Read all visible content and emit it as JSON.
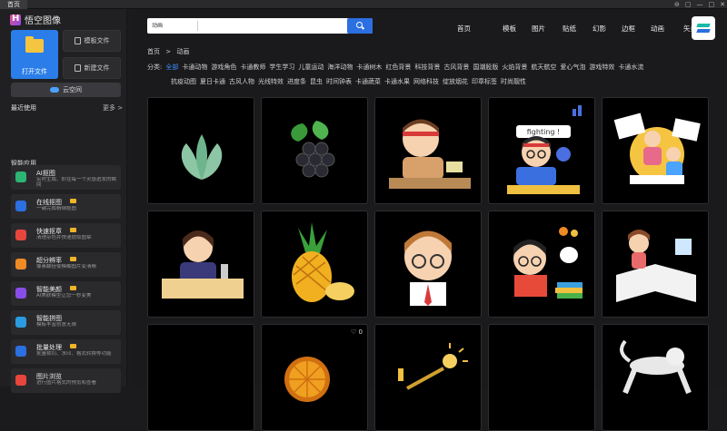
{
  "titlebar": {
    "tab": "首页",
    "controls": [
      "⊖",
      "▢",
      "—",
      "□",
      "✕"
    ]
  },
  "sidebar": {
    "app_title": "悟空图像",
    "open_file": "打开文件",
    "template_file": "模板文件",
    "new_file": "新建文件",
    "cloud": "云空间",
    "recent": "最近使用",
    "more": "更多 >",
    "smart_apps": "智能应用",
    "ai_items": [
      {
        "title": "AI抠图",
        "desc": "实时生成、抓住每一个灵感迸发的瞬间",
        "color": "#2bb673",
        "vip": false
      },
      {
        "title": "在线抠图",
        "desc": "一键完成精细抠图",
        "color": "#2b6fe0",
        "vip": true
      },
      {
        "title": "快速抠章",
        "desc": "清理杂色并快速提取图章",
        "color": "#e8453c",
        "vip": true
      },
      {
        "title": "超分辨率",
        "desc": "像素翻倍使模糊图片变清晰",
        "color": "#f08a24",
        "vip": true
      },
      {
        "title": "智能美颜",
        "desc": "AI美肤模型让您一秒变美",
        "color": "#8a4de8",
        "vip": true
      },
      {
        "title": "智能拼图",
        "desc": "模板丰富创意无限",
        "color": "#2b9be0",
        "vip": false
      },
      {
        "title": "批量处理",
        "desc": "批量裁切、水印、格式转换等功能",
        "color": "#2b6fe0",
        "vip": true
      },
      {
        "title": "图片浏览",
        "desc": "进行图片格式的预览和查看",
        "color": "#e8453c",
        "vip": false
      }
    ]
  },
  "search": {
    "category": "动画",
    "placeholder": ""
  },
  "nav": [
    "首页",
    "模板",
    "图片",
    "贴纸",
    "幻影",
    "边框",
    "动画",
    "矢量"
  ],
  "breadcrumb": {
    "home": "首页",
    "sep": ">",
    "current": "动画"
  },
  "categories": {
    "label": "分类:",
    "row1": [
      "全部",
      "卡通动物",
      "游戏角色",
      "卡通教师",
      "学生学习",
      "儿童运动",
      "海洋动物",
      "卡通树木",
      "红色背景",
      "科技背景",
      "古风背景",
      "国潮股版",
      "火焰背景",
      "航天航空",
      "爱心气泡",
      "游戏特效",
      "卡通水流"
    ],
    "row2": [
      "抗疫动图",
      "夏日卡通",
      "古风人物",
      "光线特效",
      "进度条",
      "昆虫",
      "时间钟表",
      "卡通蔬菜",
      "卡通水果",
      "网络科技",
      "绽放烟花",
      "印章标签",
      "时尚靓性"
    ]
  },
  "tiles": {
    "fighting_text": "fighting !",
    "like_count": "0"
  }
}
